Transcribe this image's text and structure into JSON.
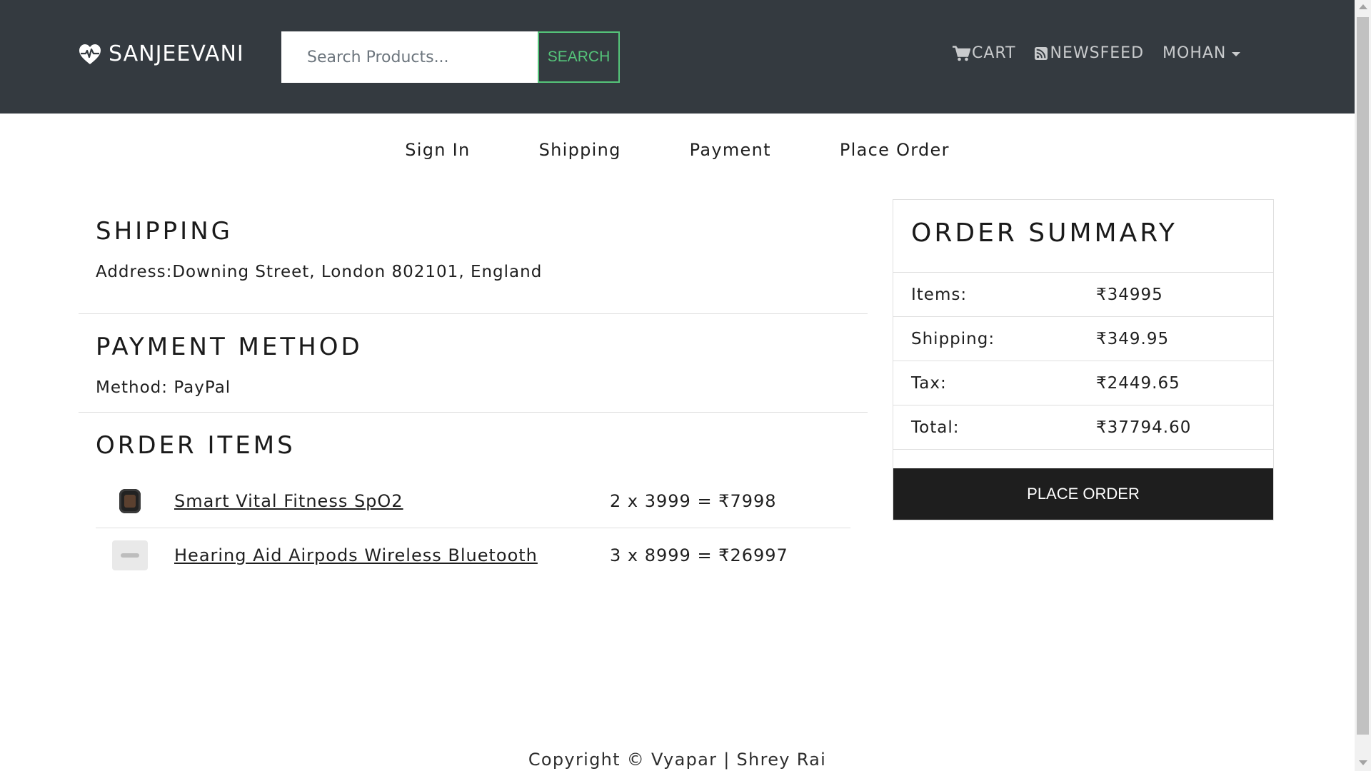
{
  "header": {
    "brand": "SANJEEVANI",
    "search_placeholder": "Search Products...",
    "search_button": "SEARCH",
    "nav": {
      "cart": "CART",
      "newsfeed": "NEWSFEED",
      "user": "MOHAN"
    },
    "colors": {
      "navbar_bg": "#343a40",
      "search_accent": "#55c57a"
    }
  },
  "steps": [
    "Sign In",
    "Shipping",
    "Payment",
    "Place Order"
  ],
  "shipping": {
    "title": "SHIPPING",
    "address_text": "Address:Downing Street, London 802101, England"
  },
  "payment": {
    "title": "PAYMENT METHOD",
    "method_text": "Method: PayPal"
  },
  "order_items": {
    "title": "ORDER ITEMS",
    "items": [
      {
        "name": "Smart Vital Fitness SpO2",
        "price_line": "2 x 3999 = ₹7998",
        "image_icon": "smartwatch-icon"
      },
      {
        "name": "Hearing Aid Airpods Wireless Bluetooth",
        "price_line": "3 x 8999 = ₹26997",
        "image_icon": "airpods-icon"
      }
    ]
  },
  "summary": {
    "title": "ORDER SUMMARY",
    "rows": [
      {
        "label": "Items:",
        "value": "₹34995"
      },
      {
        "label": "Shipping:",
        "value": "₹349.95"
      },
      {
        "label": "Tax:",
        "value": "₹2449.65"
      },
      {
        "label": "Total:",
        "value": "₹37794.60"
      }
    ],
    "button": "PLACE ORDER"
  },
  "footer": {
    "text": "Copyright © Vyapar | Shrey Rai"
  }
}
